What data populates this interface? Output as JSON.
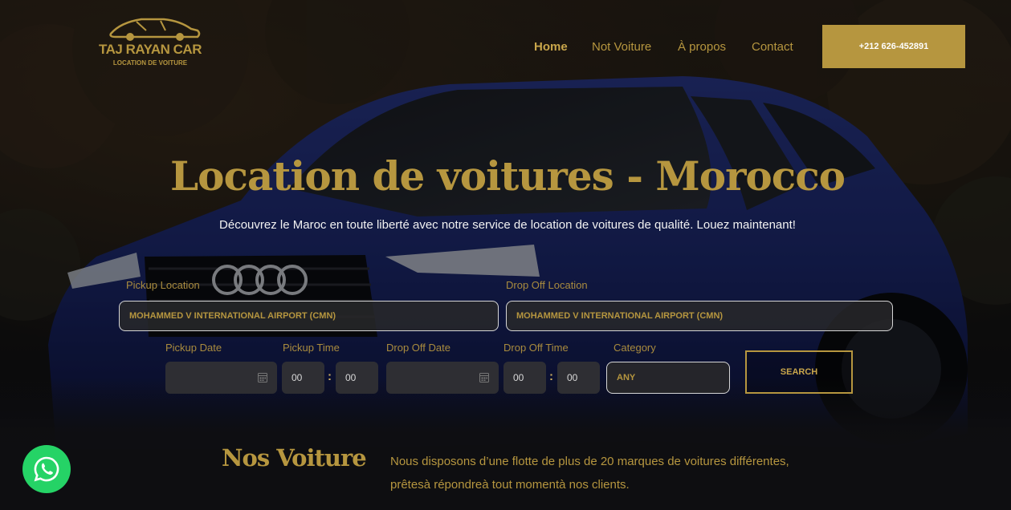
{
  "brand": {
    "name": "TAJ RAYAN CAR",
    "tagline": "LOCATION DE VOITURE",
    "logo_icon": "car-silhouette-icon",
    "accent_color": "#b6963f"
  },
  "nav": {
    "items": [
      {
        "label": "Home",
        "active": true
      },
      {
        "label": "Not Voiture",
        "active": false
      },
      {
        "label": "À propos",
        "active": false
      },
      {
        "label": "Contact",
        "active": false
      }
    ],
    "phone_label": "+212 626-452891"
  },
  "hero": {
    "title": "Location de voitures - Morocco",
    "subtitle": "Découvrez le Maroc en toute liberté avec notre service de location de voitures de qualité. Louez maintenant!"
  },
  "booking": {
    "pickup_location_label": "Pickup Location",
    "pickup_location_value": "MOHAMMED V INTERNATIONAL AIRPORT (CMN)",
    "dropoff_location_label": "Drop Off Location",
    "dropoff_location_value": "MOHAMMED V INTERNATIONAL AIRPORT (CMN)",
    "pickup_date_label": "Pickup Date",
    "pickup_date_value": "",
    "pickup_time_label": "Pickup Time",
    "pickup_hour": "00",
    "pickup_minute": "00",
    "dropoff_date_label": "Drop Off Date",
    "dropoff_date_value": "",
    "dropoff_time_label": "Drop Off Time",
    "dropoff_hour": "00",
    "dropoff_minute": "00",
    "time_separator": ":",
    "category_label": "Category",
    "category_value": "ANY",
    "search_label": "SEARCH"
  },
  "section": {
    "title": "Nos Voiture",
    "text": "Nous disposons d’une flotte de plus de 20 marques de voitures différentes, prêtesà répondreà tout momentà nos clients."
  },
  "floating": {
    "whatsapp_icon": "whatsapp-icon",
    "whatsapp_color": "#25d366"
  }
}
